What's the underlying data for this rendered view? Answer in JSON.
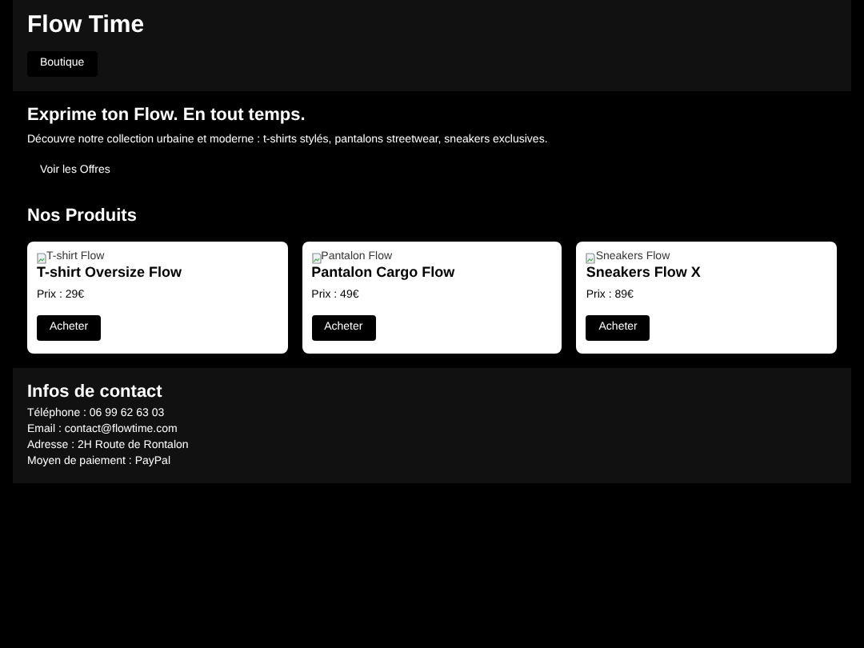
{
  "header": {
    "title": "Flow Time",
    "nav_button": "Boutique"
  },
  "hero": {
    "heading": "Exprime ton Flow. En tout temps.",
    "text": "Découvre notre collection urbaine et moderne : t-shirts stylés, pantalons streetwear, sneakers exclusives.",
    "button": "Voir les Offres"
  },
  "products": {
    "heading": "Nos Produits",
    "items": [
      {
        "image_alt": "T-shirt Flow",
        "name": "T-shirt Oversize Flow",
        "price": "Prix : 29€",
        "button": "Acheter"
      },
      {
        "image_alt": "Pantalon Flow",
        "name": "Pantalon Cargo Flow",
        "price": "Prix : 49€",
        "button": "Acheter"
      },
      {
        "image_alt": "Sneakers Flow",
        "name": "Sneakers Flow X",
        "price": "Prix : 89€",
        "button": "Acheter"
      }
    ]
  },
  "contact": {
    "heading": "Infos de contact",
    "lines": [
      "Téléphone : 06 99 62 63 03",
      "Email : contact@flowtime.com",
      "Adresse : 2H Route de Rontalon",
      "Moyen de paiement : PayPal"
    ]
  }
}
